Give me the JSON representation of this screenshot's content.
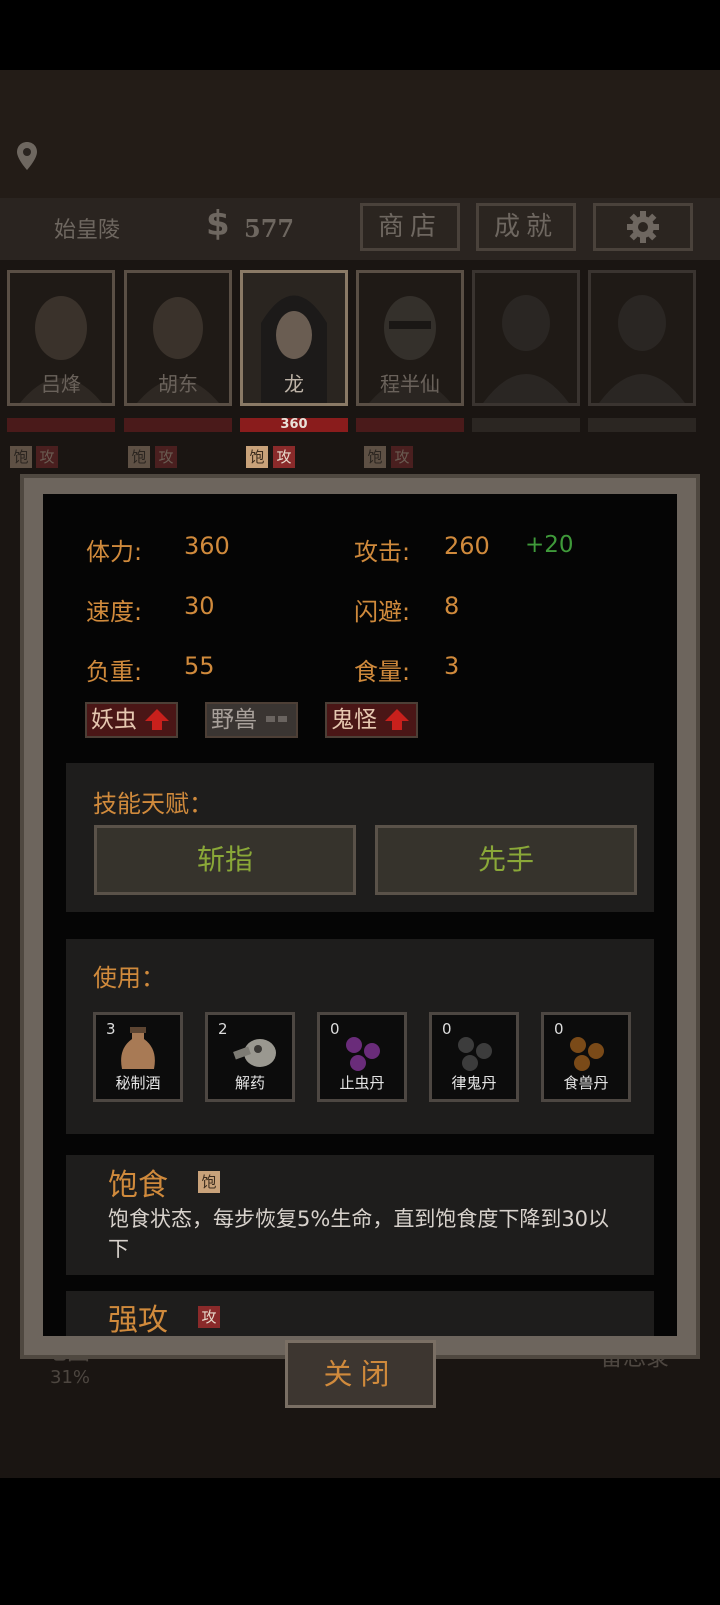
{
  "header": {
    "location_icon": "map-pin-icon",
    "location": "始皇陵",
    "money_symbol": "$",
    "money": "577",
    "shop_label": "商店",
    "achievements_label": "成就",
    "settings_icon": "gear-icon"
  },
  "party": [
    {
      "name": "吕烽",
      "hp": "",
      "selected": false
    },
    {
      "name": "胡东",
      "hp": "",
      "selected": false
    },
    {
      "name": "龙",
      "hp": "360",
      "selected": true
    },
    {
      "name": "程半仙",
      "hp": "",
      "selected": false
    },
    {
      "name": "",
      "hp": "",
      "selected": false
    },
    {
      "name": "",
      "hp": "",
      "selected": false
    }
  ],
  "status_tags": {
    "full": "饱",
    "attack": "攻"
  },
  "stats": {
    "stamina_label": "体力:",
    "stamina": "360",
    "attack_label": "攻击:",
    "attack": "260",
    "attack_bonus": "+20",
    "speed_label": "速度:",
    "speed": "30",
    "dodge_label": "闪避:",
    "dodge": "8",
    "load_label": "负重:",
    "load": "55",
    "food_label": "食量:",
    "food": "3"
  },
  "enemy_types": [
    {
      "label": "妖虫",
      "state": "up"
    },
    {
      "label": "野兽",
      "state": "neutral"
    },
    {
      "label": "鬼怪",
      "state": "up"
    }
  ],
  "skills": {
    "title": "技能天赋：",
    "items": [
      "斩指",
      "先手"
    ]
  },
  "use": {
    "title": "使用：",
    "items": [
      {
        "count": "3",
        "name": "秘制酒",
        "icon": "wine-jar-icon"
      },
      {
        "count": "2",
        "name": "解药",
        "icon": "antidote-gourd-icon"
      },
      {
        "count": "0",
        "name": "止虫丹",
        "icon": "purple-pills-icon"
      },
      {
        "count": "0",
        "name": "律鬼丹",
        "icon": "dark-pills-icon"
      },
      {
        "count": "0",
        "name": "食兽丹",
        "icon": "brown-pills-icon"
      }
    ]
  },
  "effects": [
    {
      "title": "饱食",
      "tag": "饱",
      "text": "饱食状态，每步恢复5%生命，直到饱食度下降到30以下"
    },
    {
      "title": "强攻",
      "tag": "攻",
      "text": ""
    }
  ],
  "close_label": "关闭",
  "bottom_nav": {
    "map_label": "地图",
    "map_progress": "31%",
    "memo_label": "备忘录"
  },
  "colors": {
    "accent_orange": "#d08a3c",
    "skill_green": "#8aa838",
    "bonus_green": "#3f9a3a",
    "hp_red": "#8a1c1c"
  }
}
